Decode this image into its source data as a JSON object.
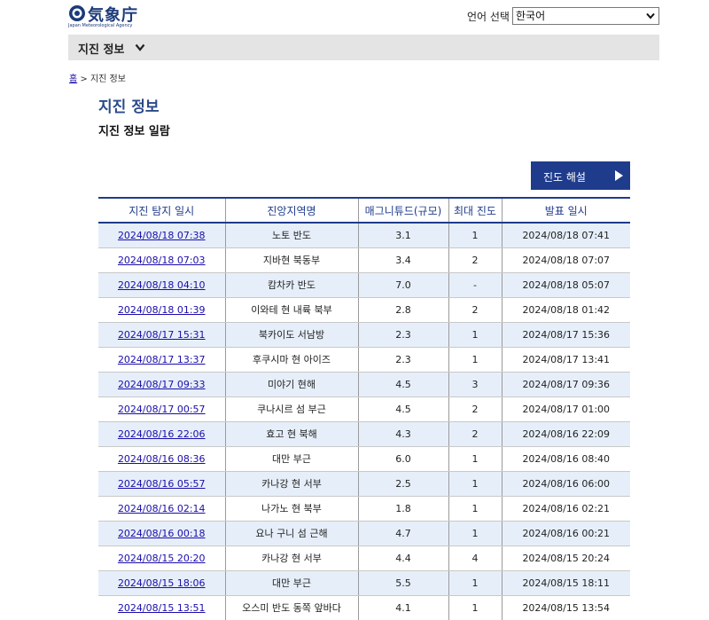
{
  "logo": {
    "text": "気象庁",
    "subtitle": "Japan Meteorological Agency"
  },
  "language": {
    "label": "언어 선택",
    "selected": "한국어"
  },
  "nav": {
    "label": "지진 정보"
  },
  "breadcrumb": {
    "home": "홈",
    "separator": ">",
    "current": "지진 정보"
  },
  "page": {
    "title": "지진 정보",
    "subtitle": "지진 정보 일람"
  },
  "explain_button": {
    "label": "진도 해설"
  },
  "colors": {
    "accent": "#1f3c8c",
    "row_alt": "#e6eff9",
    "nav_bg": "#e4e4e4",
    "link": "#1a0dab"
  },
  "table": {
    "headers": [
      "지진 탐지 일시",
      "진앙지역명",
      "매그니튜드(규모)",
      "최대 진도",
      "발표 일시"
    ],
    "rows": [
      {
        "detected": "2024/08/18 07:38",
        "region": "노토 반도",
        "magnitude": "3.1",
        "intensity": "1",
        "announced": "2024/08/18 07:41"
      },
      {
        "detected": "2024/08/18 07:03",
        "region": "지바현 북동부",
        "magnitude": "3.4",
        "intensity": "2",
        "announced": "2024/08/18 07:07"
      },
      {
        "detected": "2024/08/18 04:10",
        "region": "캄차카 반도",
        "magnitude": "7.0",
        "intensity": "-",
        "announced": "2024/08/18 05:07"
      },
      {
        "detected": "2024/08/18 01:39",
        "region": "이와테 현 내륙 북부",
        "magnitude": "2.8",
        "intensity": "2",
        "announced": "2024/08/18 01:42"
      },
      {
        "detected": "2024/08/17 15:31",
        "region": "북카이도 서남방",
        "magnitude": "2.3",
        "intensity": "1",
        "announced": "2024/08/17 15:36"
      },
      {
        "detected": "2024/08/17 13:37",
        "region": "후쿠시마 현 아이즈",
        "magnitude": "2.3",
        "intensity": "1",
        "announced": "2024/08/17 13:41"
      },
      {
        "detected": "2024/08/17 09:33",
        "region": "미야기 현해",
        "magnitude": "4.5",
        "intensity": "3",
        "announced": "2024/08/17 09:36"
      },
      {
        "detected": "2024/08/17 00:57",
        "region": "쿠나시르 섬 부근",
        "magnitude": "4.5",
        "intensity": "2",
        "announced": "2024/08/17 01:00"
      },
      {
        "detected": "2024/08/16 22:06",
        "region": "효고 현 북해",
        "magnitude": "4.3",
        "intensity": "2",
        "announced": "2024/08/16 22:09"
      },
      {
        "detected": "2024/08/16 08:36",
        "region": "대만 부근",
        "magnitude": "6.0",
        "intensity": "1",
        "announced": "2024/08/16 08:40"
      },
      {
        "detected": "2024/08/16 05:57",
        "region": "카나강 현 서부",
        "magnitude": "2.5",
        "intensity": "1",
        "announced": "2024/08/16 06:00"
      },
      {
        "detected": "2024/08/16 02:14",
        "region": "나가노 현 북부",
        "magnitude": "1.8",
        "intensity": "1",
        "announced": "2024/08/16 02:21"
      },
      {
        "detected": "2024/08/16 00:18",
        "region": "요나 구니 섬 근해",
        "magnitude": "4.7",
        "intensity": "1",
        "announced": "2024/08/16 00:21"
      },
      {
        "detected": "2024/08/15 20:20",
        "region": "카나강 현 서부",
        "magnitude": "4.4",
        "intensity": "4",
        "announced": "2024/08/15 20:24"
      },
      {
        "detected": "2024/08/15 18:06",
        "region": "대만 부근",
        "magnitude": "5.5",
        "intensity": "1",
        "announced": "2024/08/15 18:11"
      },
      {
        "detected": "2024/08/15 13:51",
        "region": "오스미 반도 동쪽 앞바다",
        "magnitude": "4.1",
        "intensity": "1",
        "announced": "2024/08/15 13:54"
      }
    ]
  }
}
